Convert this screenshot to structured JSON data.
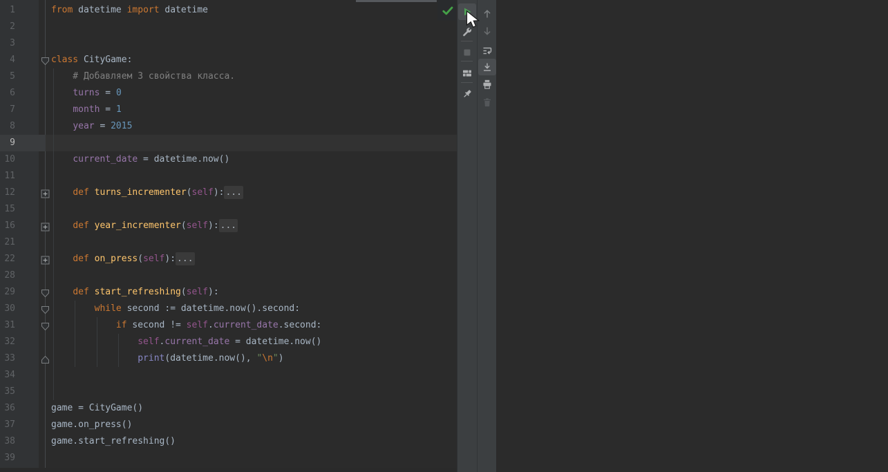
{
  "app": {
    "kind": "pycharm-editor-with-run-toolwindow",
    "theme": "darcula"
  },
  "colors": {
    "editor_bg": "#2b2b2b",
    "gutter_bg": "#313335",
    "toolbar_bg": "#3c3f41",
    "current_line_bg": "#323232",
    "keyword": "#CC7832",
    "plain": "#A9B7C6",
    "number": "#6897BB",
    "comment": "#808080",
    "function_name": "#FFC66D",
    "self_param": "#94558D",
    "attribute": "#9876AA",
    "builtin": "#8888C6",
    "string": "#6A8759",
    "escape": "#CC7832",
    "run_green": "#4E9D56",
    "check_green": "#44A147"
  },
  "editor": {
    "current_line": "9",
    "lines": [
      {
        "n": "1",
        "s": [
          [
            "k",
            "from"
          ],
          [
            "p",
            " datetime "
          ],
          [
            "k",
            "import"
          ],
          [
            "p",
            " datetime"
          ]
        ]
      },
      {
        "n": "2",
        "s": []
      },
      {
        "n": "3",
        "s": []
      },
      {
        "n": "4",
        "fold": "open",
        "s": [
          [
            "k",
            "class"
          ],
          [
            "p",
            " CityGame:"
          ]
        ]
      },
      {
        "n": "5",
        "g": [
          0
        ],
        "s": [
          [
            "c",
            "    # Добавляем 3 свойства класса."
          ]
        ]
      },
      {
        "n": "6",
        "g": [
          0
        ],
        "s": [
          [
            "p",
            "    "
          ],
          [
            "a",
            "turns"
          ],
          [
            "p",
            " = "
          ],
          [
            "n",
            "0"
          ]
        ]
      },
      {
        "n": "7",
        "g": [
          0
        ],
        "s": [
          [
            "p",
            "    "
          ],
          [
            "a",
            "month"
          ],
          [
            "p",
            " = "
          ],
          [
            "n",
            "1"
          ]
        ]
      },
      {
        "n": "8",
        "g": [
          0
        ],
        "s": [
          [
            "p",
            "    "
          ],
          [
            "a",
            "year"
          ],
          [
            "p",
            " = "
          ],
          [
            "n",
            "2015"
          ]
        ]
      },
      {
        "n": "9",
        "g": [
          0
        ],
        "current": true,
        "s": []
      },
      {
        "n": "10",
        "g": [
          0
        ],
        "s": [
          [
            "p",
            "    "
          ],
          [
            "a",
            "current_date"
          ],
          [
            "p",
            " = datetime.now()"
          ]
        ]
      },
      {
        "n": "11",
        "g": [
          0
        ],
        "s": []
      },
      {
        "n": "12",
        "fold": "closed",
        "g": [
          0
        ],
        "s": [
          [
            "p",
            "    "
          ],
          [
            "k",
            "def"
          ],
          [
            "p",
            " "
          ],
          [
            "f",
            "turns_incrementer"
          ],
          [
            "p",
            "("
          ],
          [
            "s",
            "self"
          ],
          [
            "p",
            "):"
          ],
          [
            "F",
            "..."
          ]
        ]
      },
      {
        "n": "15",
        "g": [
          0
        ],
        "s": []
      },
      {
        "n": "16",
        "fold": "closed",
        "g": [
          0
        ],
        "s": [
          [
            "p",
            "    "
          ],
          [
            "k",
            "def"
          ],
          [
            "p",
            " "
          ],
          [
            "f",
            "year_incrementer"
          ],
          [
            "p",
            "("
          ],
          [
            "s",
            "self"
          ],
          [
            "p",
            "):"
          ],
          [
            "F",
            "..."
          ]
        ]
      },
      {
        "n": "21",
        "g": [
          0
        ],
        "s": []
      },
      {
        "n": "22",
        "fold": "closed",
        "g": [
          0
        ],
        "s": [
          [
            "p",
            "    "
          ],
          [
            "k",
            "def"
          ],
          [
            "p",
            " "
          ],
          [
            "f",
            "on_press"
          ],
          [
            "p",
            "("
          ],
          [
            "s",
            "self"
          ],
          [
            "p",
            "):"
          ],
          [
            "F",
            "..."
          ]
        ]
      },
      {
        "n": "28",
        "g": [
          0
        ],
        "s": []
      },
      {
        "n": "29",
        "fold": "open",
        "g": [
          0
        ],
        "s": [
          [
            "p",
            "    "
          ],
          [
            "k",
            "def"
          ],
          [
            "p",
            " "
          ],
          [
            "f",
            "start_refreshing"
          ],
          [
            "p",
            "("
          ],
          [
            "s",
            "self"
          ],
          [
            "p",
            "):"
          ]
        ]
      },
      {
        "n": "30",
        "fold": "open",
        "g": [
          0,
          4
        ],
        "s": [
          [
            "p",
            "        "
          ],
          [
            "k",
            "while"
          ],
          [
            "p",
            " second := datetime.now().second:"
          ]
        ]
      },
      {
        "n": "31",
        "fold": "open",
        "g": [
          0,
          4,
          8
        ],
        "s": [
          [
            "p",
            "            "
          ],
          [
            "k",
            "if"
          ],
          [
            "p",
            " second != "
          ],
          [
            "s",
            "self"
          ],
          [
            "p",
            "."
          ],
          [
            "a",
            "current_date"
          ],
          [
            "p",
            ".second:"
          ]
        ]
      },
      {
        "n": "32",
        "g": [
          0,
          4,
          8,
          12
        ],
        "s": [
          [
            "p",
            "                "
          ],
          [
            "s",
            "self"
          ],
          [
            "p",
            "."
          ],
          [
            "a",
            "current_date"
          ],
          [
            "p",
            " = datetime.now()"
          ]
        ]
      },
      {
        "n": "33",
        "fold": "end",
        "g": [
          0,
          4,
          8,
          12
        ],
        "s": [
          [
            "p",
            "                "
          ],
          [
            "b",
            "print"
          ],
          [
            "p",
            "(datetime.now(), "
          ],
          [
            "q",
            "\""
          ],
          [
            "e",
            "\\n"
          ],
          [
            "q",
            "\""
          ],
          [
            "p",
            ")"
          ]
        ]
      },
      {
        "n": "34",
        "g": [
          0
        ],
        "s": []
      },
      {
        "n": "35",
        "g": [
          0
        ],
        "s": []
      },
      {
        "n": "36",
        "s": [
          [
            "p",
            "game = CityGame()"
          ]
        ]
      },
      {
        "n": "37",
        "s": [
          [
            "p",
            "game.on_press()"
          ]
        ]
      },
      {
        "n": "38",
        "s": [
          [
            "p",
            "game.start_refreshing()"
          ]
        ]
      },
      {
        "n": "39",
        "s": []
      }
    ]
  },
  "inspections": {
    "status": "ok",
    "icon": "check-icon"
  },
  "run_toolbar": {
    "buttons": [
      {
        "icon": "run-icon",
        "state": "hover",
        "enabled": true
      },
      {
        "icon": "wrench-icon",
        "enabled": true
      },
      {
        "type": "separator"
      },
      {
        "icon": "stop-icon",
        "enabled": false
      },
      {
        "type": "separator"
      },
      {
        "icon": "restore-layout-icon",
        "enabled": true
      },
      {
        "type": "separator"
      },
      {
        "icon": "pin-icon",
        "enabled": true
      }
    ]
  },
  "console_toolbar": {
    "buttons": [
      {
        "icon": "arrow-up-icon",
        "enabled": false
      },
      {
        "icon": "arrow-down-icon",
        "enabled": false
      },
      {
        "icon": "soft-wrap-icon",
        "enabled": true
      },
      {
        "icon": "scroll-to-end-icon",
        "selected": true,
        "enabled": true
      },
      {
        "icon": "print-icon",
        "enabled": true
      },
      {
        "icon": "trash-icon",
        "enabled": false
      }
    ]
  },
  "cursor": {
    "icon": "mouse-pointer-icon",
    "over": "run-button"
  }
}
